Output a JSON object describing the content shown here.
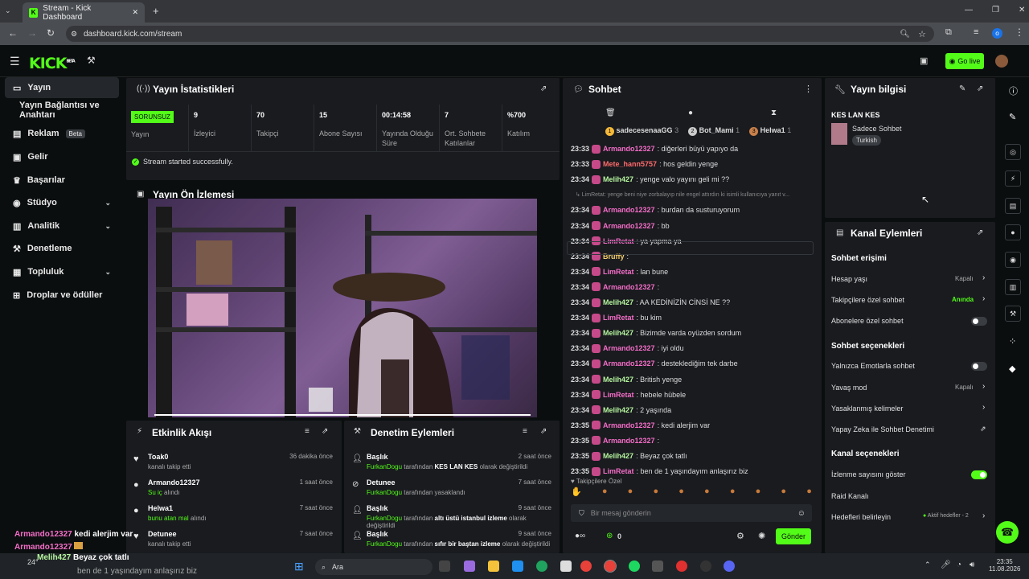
{
  "browser": {
    "tab_title": "Stream - Kick Dashboard",
    "url": "dashboard.kick.com/stream",
    "new_tab": "+"
  },
  "app": {
    "logo": "KICK",
    "logo_badge": "BETA",
    "go_live": "Go live"
  },
  "sidebar": {
    "items": [
      {
        "label": "Yayın",
        "active": true
      },
      {
        "label": "Yayın Bağlantısı ve Anahtarı"
      },
      {
        "label": "Reklam",
        "badge": "Beta"
      },
      {
        "label": "Gelir"
      },
      {
        "label": "Başarılar"
      },
      {
        "label": "Stüdyo",
        "chevron": true
      },
      {
        "label": "Analitik",
        "chevron": true
      },
      {
        "label": "Denetleme"
      },
      {
        "label": "Topluluk",
        "chevron": true
      },
      {
        "label": "Droplar ve ödüller"
      }
    ]
  },
  "stats": {
    "title": "Yayın İstatistikleri",
    "status_badge": "SORUNSUZ",
    "status_label": "Yayın",
    "viewers": "9",
    "viewers_label": "İzleyici",
    "followers": "70",
    "followers_label": "Takipçi",
    "subs": "15",
    "subs_label": "Abone Sayısı",
    "duration": "00:14:58",
    "duration_label": "Yayında Olduğu Süre",
    "chatters": "7",
    "chatters_label": "Ort. Sohbete Katılanlar",
    "participation": "%700",
    "participation_label": "Katılım",
    "success_msg": "Stream started successfully."
  },
  "preview": {
    "title": "Yayın Ön İzlemesi"
  },
  "events": {
    "title": "Etkinlik Akışı",
    "items": [
      {
        "name": "Toak0",
        "sub": "kanalı takip etti",
        "time": "36 dakika önce"
      },
      {
        "name": "Armando12327",
        "sub_hl": "Su iç",
        "sub": "alındı",
        "time": "1 saat önce"
      },
      {
        "name": "Helwa1",
        "sub_hl": "bunu atan mal",
        "sub": "alındı",
        "time": "7 saat önce"
      },
      {
        "name": "Detunee",
        "sub": "kanalı takip etti",
        "time": "7 saat önce"
      }
    ]
  },
  "mod": {
    "title": "Denetim Eylemleri",
    "items": [
      {
        "name": "Başlık",
        "actor": "FurkanDogu",
        "mid": "tarafından",
        "val": "KES LAN KES",
        "end": "olarak değiştirildi",
        "time": "2 saat önce"
      },
      {
        "name": "Detunee",
        "actor": "FurkanDogu",
        "mid": "tarafından yasaklandı",
        "val": "",
        "end": "",
        "time": "7 saat önce"
      },
      {
        "name": "Başlık",
        "actor": "FurkanDogu",
        "mid": "tarafından",
        "val": "altı üstü istanbul izleme",
        "end": "olarak değiştirildi",
        "time": "9 saat önce"
      },
      {
        "name": "Başlık",
        "actor": "FurkanDogu",
        "mid": "tarafından",
        "val": "sıfır bir baştan izleme",
        "end": "olarak değiştirildi",
        "time": "9 saat önce"
      }
    ]
  },
  "chat": {
    "title": "Sohbet",
    "top_users": [
      {
        "rank": "1",
        "name": "sadecesenaaGG",
        "count": "3"
      },
      {
        "rank": "2",
        "name": "Bot_Mami",
        "count": "1"
      },
      {
        "rank": "3",
        "name": "Helwa1",
        "count": "1"
      }
    ],
    "messages": [
      {
        "time": "23:33",
        "user": "Armando12327",
        "cls": "u-pink",
        "text": ": diğerleri büyü yapıyo da"
      },
      {
        "time": "23:33",
        "user": "Mete_hann5757",
        "cls": "u-red",
        "text": ": hos geldin yenge"
      },
      {
        "time": "23:34",
        "user": "Melih427",
        "cls": "u-green",
        "text": ": yenge valo yayını geli mi ??"
      },
      {
        "time": "",
        "user": "",
        "cls": "m",
        "text": "↳ LimRetat: yenge beni niye zorbalayıp nile engel attırdın ki isimli kullanıcıya yanıt v..."
      },
      {
        "time": "23:34",
        "user": "Armando12327",
        "cls": "u-pink",
        "text": ": burdan da susturuyorum"
      },
      {
        "time": "23:34",
        "user": "Armando12327",
        "cls": "u-pink",
        "text": ": bb"
      },
      {
        "time": "23:34",
        "user": "LimRetat",
        "cls": "u-pink",
        "text": ": ya yapma ya"
      },
      {
        "time": "23:34",
        "user": "Bruffy",
        "cls": "u-yellow",
        "text": ":"
      },
      {
        "time": "23:34",
        "user": "LimRetat",
        "cls": "u-pink",
        "text": ": lan bune"
      },
      {
        "time": "23:34",
        "user": "Armando12327",
        "cls": "u-pink",
        "text": ":"
      },
      {
        "time": "23:34",
        "user": "Melih427",
        "cls": "u-green",
        "text": ": AA KEDİNİZİN CİNSİ NE ??"
      },
      {
        "time": "23:34",
        "user": "LimRetat",
        "cls": "u-pink",
        "text": ": bu kim"
      },
      {
        "time": "23:34",
        "user": "Melih427",
        "cls": "u-green",
        "text": ": Bizimde varda oyüzden sordum"
      },
      {
        "time": "23:34",
        "user": "Armando12327",
        "cls": "u-pink",
        "text": ": iyi oldu"
      },
      {
        "time": "23:34",
        "user": "Armando12327",
        "cls": "u-pink",
        "text": ": desteklediğim tek darbe"
      },
      {
        "time": "23:34",
        "user": "Melih427",
        "cls": "u-green",
        "text": ": British yenge"
      },
      {
        "time": "23:34",
        "user": "LimRetat",
        "cls": "u-pink",
        "text": ": hebele hübele"
      },
      {
        "time": "23:34",
        "user": "Melih427",
        "cls": "u-green",
        "text": ": 2 yaşında"
      },
      {
        "time": "23:35",
        "user": "Armando12327",
        "cls": "u-pink",
        "text": ": kedi alerjim var"
      },
      {
        "time": "23:35",
        "user": "Armando12327",
        "cls": "u-pink",
        "text": ":"
      },
      {
        "time": "23:35",
        "user": "Melih427",
        "cls": "u-green",
        "text": ": Beyaz çok tatlı"
      },
      {
        "time": "23:35",
        "user": "LimRetat",
        "cls": "u-pink",
        "text": ": ben de 1 yaşındayım anlaşırız biz"
      }
    ],
    "followers_only": "Takipçilere Özel",
    "placeholder": "Bir mesaj gönderin",
    "points": "0",
    "send": "Gönder"
  },
  "info": {
    "title": "Yayın bilgisi",
    "stream_title": "KES LAN KES",
    "category": "Sadece Sohbet",
    "tag": "Turkish"
  },
  "actions": {
    "title": "Kanal Eylemleri",
    "chat_access": "Sohbet erişimi",
    "account_age": "Hesap yaşı",
    "account_age_val": "Kapalı",
    "followers_chat": "Takipçilere özel sohbet",
    "followers_chat_val": "Anında",
    "subs_chat": "Abonelere özel sohbet",
    "chat_options": "Sohbet seçenekleri",
    "emote_only": "Yalnızca Emotlarla sohbet",
    "slow_mode": "Yavaş mod",
    "slow_mode_val": "Kapalı",
    "banned_words": "Yasaklanmış kelimeler",
    "ai_mod": "Yapay Zeka ile Sohbet Denetimi",
    "channel_options": "Kanal seçenekleri",
    "show_viewers": "İzlenme sayısını göster",
    "raid": "Raid Kanalı",
    "goals": "Hedefleri belirleyin",
    "goals_val": "Aktif hedefler - 2"
  },
  "overlay": {
    "l1_user": "Armando12327",
    "l1_text": "kedi alerjim var",
    "l2_user": "Armando12327",
    "l3_user": "Melih427",
    "l3_text": "Beyaz çok tatlı",
    "l4_text": "ben de 1 yaşındayım anlaşırız biz"
  },
  "taskbar": {
    "search": "Ara",
    "time": "23:35",
    "date": "11.08.2026",
    "weather": "24°"
  },
  "colors": {
    "accent": "#53fc18",
    "panel": "#191b1f",
    "bg": "#0b0e0f"
  }
}
